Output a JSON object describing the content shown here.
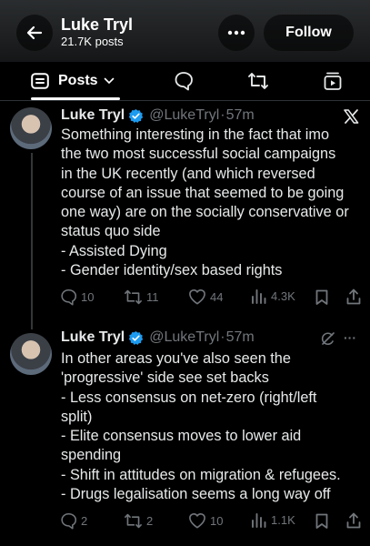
{
  "header": {
    "title": "Luke Tryl",
    "subtitle": "21.7K posts",
    "follow_label": "Follow"
  },
  "tabs": {
    "posts_label": "Posts"
  },
  "icons": [
    "back-arrow-icon",
    "more-icon",
    "posts-icon",
    "chevron-down-icon",
    "reply-icon",
    "repost-icon",
    "media-icon",
    "x-logo-icon",
    "verified-icon",
    "grok-icon",
    "like-icon",
    "views-icon",
    "bookmark-icon",
    "share-icon"
  ],
  "colors": {
    "verified": "#1d9bf0",
    "muted": "#71767b",
    "text": "#e7e9ea"
  },
  "posts": [
    {
      "name": "Luke Tryl",
      "handle": "@LukeTryl",
      "dot": "·",
      "time": "57m",
      "lines": [
        "Something interesting in the fact that imo",
        "the two most successful social campaigns",
        "in the UK recently (and which reversed",
        "course of an issue that seemed to be going",
        "one way) are on the socially conservative or",
        "status quo side",
        "- Assisted Dying",
        "- Gender identity/sex based rights"
      ],
      "replies": "10",
      "reposts": "11",
      "likes": "44",
      "views": "4.3K"
    },
    {
      "name": "Luke Tryl",
      "handle": "@LukeTryl",
      "dot": "·",
      "time": "57m",
      "more": "···",
      "lines": [
        "In other areas you've also seen the",
        "'progressive' side see set backs",
        "- Less consensus on net-zero (right/left",
        "split)",
        "- Elite consensus moves to lower aid",
        "spending",
        "- Shift in attitudes on migration & refugees.",
        "- Drugs legalisation seems a long way off"
      ],
      "replies": "2",
      "reposts": "2",
      "likes": "10",
      "views": "1.1K"
    }
  ]
}
